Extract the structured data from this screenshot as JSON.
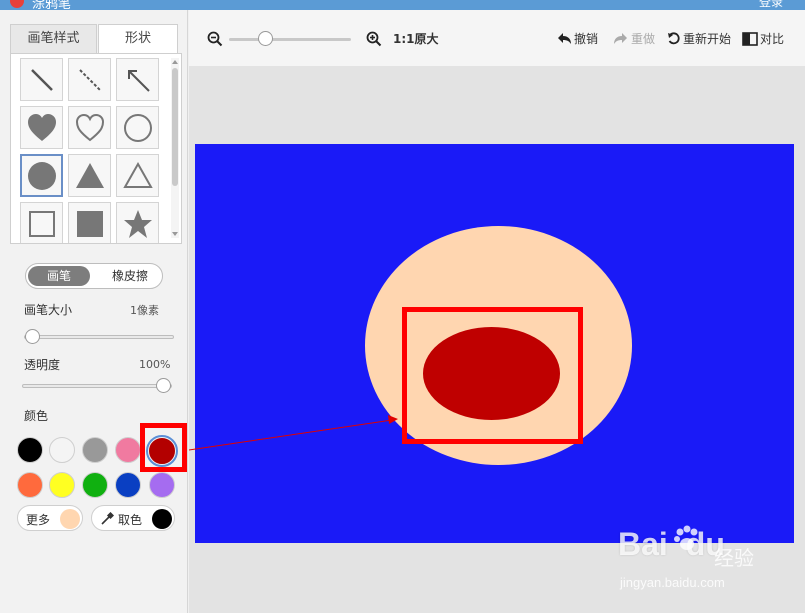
{
  "titlebar": {
    "app_title": "涂鸦笔",
    "login": "登录"
  },
  "tabs": [
    {
      "label": "画笔样式"
    },
    {
      "label": "形状"
    }
  ],
  "shapes": [
    "line",
    "dashed-line",
    "arrow",
    "heart-filled",
    "heart-outline",
    "circle-outline",
    "circle-filled",
    "triangle-filled",
    "triangle-outline",
    "square-outline",
    "square-filled",
    "star"
  ],
  "selected_shape": "circle-filled",
  "mode": {
    "brush_label": "画笔",
    "eraser_label": "橡皮擦",
    "active": "brush"
  },
  "brush_size": {
    "label": "画笔大小",
    "value": "1像素",
    "level": 0
  },
  "opacity": {
    "label": "透明度",
    "value": "100%",
    "level": 1
  },
  "colors": {
    "label": "颜色",
    "palette": [
      "#000000",
      "#f4f4f4",
      "#999999",
      "#f07aa0",
      "#b30000",
      "#ff6a3d",
      "#ffff22",
      "#10b010",
      "#0a3fc2",
      "#a56cf0"
    ],
    "selected": "#b30000",
    "more_label": "更多",
    "more_color": "#ffd6b0",
    "pick_label": "取色",
    "pick_color": "#000000"
  },
  "toolbar": {
    "zoom_label": "1:1原大",
    "zoom_level": 0.3,
    "undo_label": "撤销",
    "redo_label": "重做",
    "restart_label": "重新开始",
    "compare_label": "对比"
  },
  "canvas": {
    "background": "#1a1af7",
    "face_color": "#ffd6b0",
    "mouth_color": "#bf0000"
  },
  "watermark": {
    "brand": "Bai",
    "brand2": "du",
    "jingyan": "经验",
    "url": "jingyan.baidu.com"
  }
}
